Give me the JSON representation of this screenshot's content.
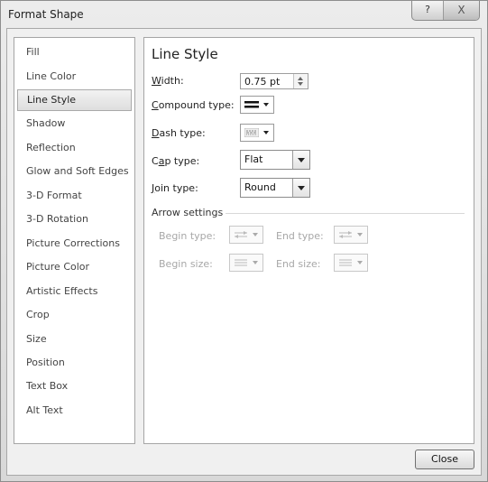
{
  "window": {
    "title": "Format Shape",
    "help_label": "?",
    "close_glyph": "X"
  },
  "sidebar": {
    "items": [
      {
        "label": "Fill"
      },
      {
        "label": "Line Color"
      },
      {
        "label": "Line Style",
        "selected": true
      },
      {
        "label": "Shadow"
      },
      {
        "label": "Reflection"
      },
      {
        "label": "Glow and Soft Edges"
      },
      {
        "label": "3-D Format"
      },
      {
        "label": "3-D Rotation"
      },
      {
        "label": "Picture Corrections"
      },
      {
        "label": "Picture Color"
      },
      {
        "label": "Artistic Effects"
      },
      {
        "label": "Crop"
      },
      {
        "label": "Size"
      },
      {
        "label": "Position"
      },
      {
        "label": "Text Box"
      },
      {
        "label": "Alt Text"
      }
    ]
  },
  "main": {
    "section_title": "Line Style",
    "width": {
      "mnemonic": "W",
      "rest": "idth:",
      "value": "0.75 pt"
    },
    "compound_type": {
      "mnemonic": "C",
      "rest": "ompound type:",
      "icon": "double-line-icon"
    },
    "dash_type": {
      "mnemonic": "D",
      "rest": "ash type:",
      "icon": "dash-pattern-icon"
    },
    "cap_type": {
      "pre": "C",
      "mnemonic": "a",
      "rest": "p type:",
      "value": "Flat"
    },
    "join_type": {
      "mnemonic": "J",
      "rest": "oin type:",
      "value": "Round"
    },
    "arrow_settings": {
      "label": "Arrow settings",
      "begin_type": "Begin type:",
      "end_type": "End type:",
      "begin_size": "Begin size:",
      "end_size": "End size:"
    }
  },
  "footer": {
    "close_label": "Close"
  },
  "colors": {
    "accent": "#a5a5a5",
    "disabled_text": "#a7a7a7",
    "selected_bg": "#e6e6e6"
  }
}
